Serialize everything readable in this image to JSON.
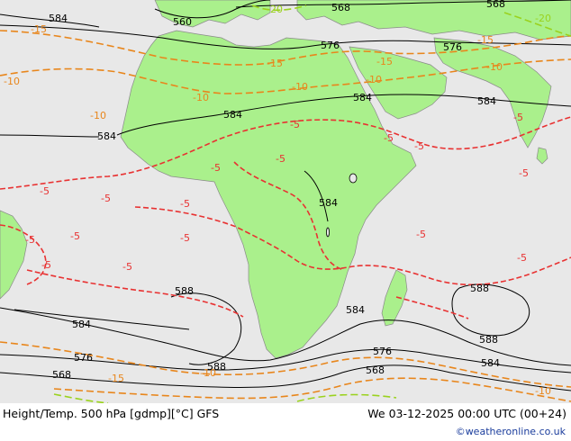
{
  "colors": {
    "sea": "#e8e8e8",
    "land": "#aaf08c",
    "height_contour": "#000000",
    "temp_minus5": "#e83232",
    "temp_minus10": "#e8861c",
    "temp_minus15": "#e8861c",
    "temp_minus20": "#9ad21e",
    "footer_credit": "#1a3c9c"
  },
  "height_labels": [
    "584",
    "560",
    "568",
    "568",
    "576",
    "576",
    "584",
    "584",
    "584",
    "584",
    "584",
    "588",
    "588",
    "588",
    "584",
    "576",
    "576",
    "568",
    "568",
    "588",
    "584",
    "584"
  ],
  "temp_labels": {
    "minus5": [
      "-5",
      "-5",
      "-5",
      "-5",
      "-5",
      "-5",
      "-5",
      "-5",
      "-5",
      "-5",
      "-5",
      "-5",
      "-5",
      "-5",
      "-5",
      "-5",
      "-5"
    ],
    "minus10": [
      "-10",
      "-10",
      "-10",
      "-10",
      "-10",
      "-10",
      "-10",
      "-10"
    ],
    "minus15": [
      "-15",
      "-15",
      "-15",
      "-15",
      "-15"
    ],
    "minus20": [
      "-20",
      "-20"
    ]
  },
  "footer": {
    "title": "Height/Temp. 500 hPa [gdmp][°C] GFS",
    "valid_time": "We 03-12-2025 00:00 UTC (00+24)",
    "credit": "©weatheronline.co.uk"
  }
}
